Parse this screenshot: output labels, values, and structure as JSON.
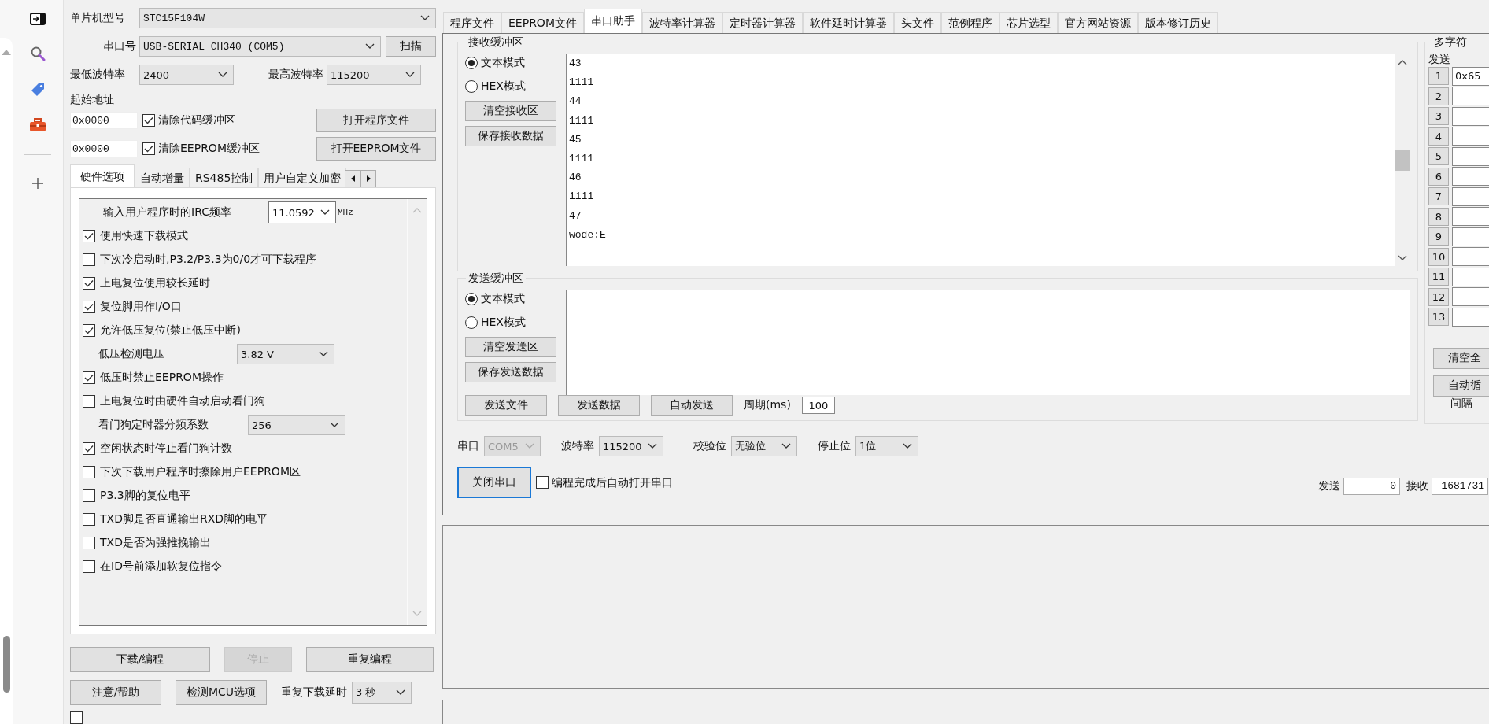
{
  "left_panel": {
    "mcu_model": {
      "label": "单片机型号",
      "value": "STC15F104W"
    },
    "port": {
      "label": "串口号",
      "value": "USB-SERIAL CH340 (COM5)",
      "button": "扫描"
    },
    "baud_range": [
      {
        "label": "最低波特率",
        "value": "2400"
      },
      {
        "label": "最高波特率",
        "value": "115200"
      }
    ],
    "start_address": {
      "label": "起始地址",
      "rows": [
        {
          "value": "0x0000",
          "checkbox": "清除代码缓冲区",
          "checked": true,
          "button": "打开程序文件"
        },
        {
          "value": "0x0000",
          "checkbox": "清除EEPROM缓冲区",
          "checked": true,
          "button": "打开EEPROM文件"
        }
      ]
    },
    "tabs": [
      {
        "label": "硬件选项",
        "selected": true
      },
      {
        "label": "自动增量",
        "selected": false
      },
      {
        "label": "RS485控制",
        "selected": false
      },
      {
        "label": "用户自定义加密",
        "selected": false
      }
    ],
    "options": [
      {
        "kind": "combo",
        "label": "输入用户程序时的IRC频率",
        "value": "11.0592",
        "unit": "MHz"
      },
      {
        "kind": "checkbox",
        "label": "使用快速下载模式",
        "checked": true
      },
      {
        "kind": "checkbox",
        "label": "下次冷启动时,P3.2/P3.3为0/0才可下载程序",
        "checked": false
      },
      {
        "kind": "checkbox",
        "label": "上电复位使用较长延时",
        "checked": true
      },
      {
        "kind": "checkbox",
        "label": "复位脚用作I/O口",
        "checked": true
      },
      {
        "kind": "checkbox",
        "label": "允许低压复位(禁止低压中断)",
        "checked": true
      },
      {
        "kind": "combo",
        "label": "低压检测电压",
        "value": "3.82 V"
      },
      {
        "kind": "checkbox",
        "label": "低压时禁止EEPROM操作",
        "checked": true
      },
      {
        "kind": "checkbox",
        "label": "上电复位时由硬件自动启动看门狗",
        "checked": false
      },
      {
        "kind": "combo",
        "label": "看门狗定时器分频系数",
        "value": "256"
      },
      {
        "kind": "checkbox",
        "label": "空闲状态时停止看门狗计数",
        "checked": true
      },
      {
        "kind": "checkbox",
        "label": "下次下载用户程序时擦除用户EEPROM区",
        "checked": false
      },
      {
        "kind": "checkbox",
        "label": "P3.3脚的复位电平",
        "checked": false
      },
      {
        "kind": "checkbox",
        "label": "TXD脚是否直通输出RXD脚的电平",
        "checked": false
      },
      {
        "kind": "checkbox",
        "label": "TXD是否为强推挽输出",
        "checked": false
      },
      {
        "kind": "checkbox",
        "label": "在ID号前添加软复位指令",
        "checked": false
      }
    ],
    "buttons": [
      {
        "label": "下载/编程",
        "disabled": false
      },
      {
        "label": "停止",
        "disabled": true
      },
      {
        "label": "重复编程",
        "disabled": false
      }
    ],
    "help_button": "注意/帮助",
    "detect_button": "检测MCU选项",
    "cut_off_option": {
      "checked": false
    },
    "repeat_delay": {
      "label": "重复下载延时",
      "value": "3 秒"
    }
  },
  "main_tabs": [
    {
      "label": "程序文件",
      "selected": false
    },
    {
      "label": "EEPROM文件",
      "selected": false
    },
    {
      "label": "串口助手",
      "selected": true
    },
    {
      "label": "波特率计算器",
      "selected": false
    },
    {
      "label": "定时器计算器",
      "selected": false
    },
    {
      "label": "软件延时计算器",
      "selected": false
    },
    {
      "label": "头文件",
      "selected": false
    },
    {
      "label": "范例程序",
      "selected": false
    },
    {
      "label": "芯片选型",
      "selected": false
    },
    {
      "label": "官方网站资源",
      "selected": false
    },
    {
      "label": "版本修订历史",
      "selected": false
    }
  ],
  "receive": {
    "title": "接收缓冲区",
    "modes": [
      {
        "label": "文本模式",
        "selected": true
      },
      {
        "label": "HEX模式",
        "selected": false
      }
    ],
    "buttons": [
      "清空接收区",
      "保存接收数据"
    ],
    "lines": [
      "43",
      "1111",
      "44",
      "1111",
      "45",
      "1111",
      "46",
      "1111",
      "47",
      "wode:E"
    ]
  },
  "send": {
    "title": "发送缓冲区",
    "modes": [
      {
        "label": "文本模式",
        "selected": true
      },
      {
        "label": "HEX模式",
        "selected": false
      }
    ],
    "buttons": [
      "清空发送区",
      "保存发送数据"
    ],
    "actions": [
      "发送文件",
      "发送数据",
      "自动发送"
    ],
    "period": {
      "label": "周期(ms)",
      "value": "100"
    }
  },
  "multi_send": {
    "title": "多字符",
    "send_label": "发送",
    "rows": [
      {
        "number": "1",
        "value": "0x65"
      },
      {
        "number": "2"
      },
      {
        "number": "3"
      },
      {
        "number": "4"
      },
      {
        "number": "5"
      },
      {
        "number": "6"
      },
      {
        "number": "7"
      },
      {
        "number": "8"
      },
      {
        "number": "9"
      },
      {
        "number": "10"
      },
      {
        "number": "11"
      },
      {
        "number": "12"
      },
      {
        "number": "13"
      }
    ],
    "buttons": [
      "清空全",
      "自动循"
    ],
    "interval_label": "间隔"
  },
  "serial_settings": [
    {
      "label": "串口",
      "value": "COM5",
      "disabled": true
    },
    {
      "label": "波特率",
      "value": "115200",
      "disabled": false
    },
    {
      "label": "校验位",
      "value": "无验位",
      "disabled": false
    },
    {
      "label": "停止位",
      "value": "1位",
      "disabled": false
    }
  ],
  "close_port_button": {
    "label": "关闭串口",
    "focused": true
  },
  "auto_open": {
    "label": "编程完成后自动打开串口",
    "checked": false
  },
  "counters": [
    {
      "label": "发送",
      "value": "0"
    },
    {
      "label": "接收",
      "value": "1681731"
    }
  ]
}
